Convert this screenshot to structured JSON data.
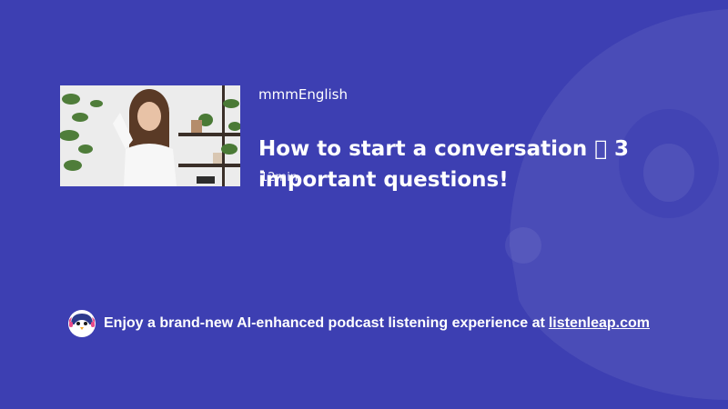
{
  "episode": {
    "channel": "mmmEnglish",
    "title": "How to start a conversation  3 important questions!",
    "duration": "12min"
  },
  "promo": {
    "text": "Enjoy a brand-new AI-enhanced podcast listening experience at",
    "link_text": "listenleap.com"
  },
  "icons": {
    "background": "penguin-mascot-icon",
    "promo_logo": "penguin-logo-icon"
  },
  "colors": {
    "background": "#3d3fb2",
    "text": "#ffffff"
  }
}
